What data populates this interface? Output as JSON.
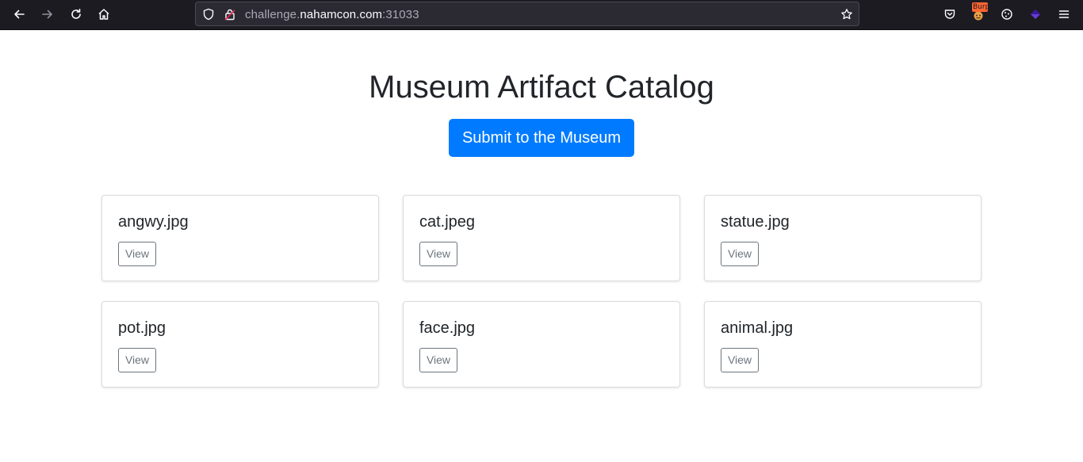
{
  "browser": {
    "url_prefix": "challenge.",
    "url_domain": "nahamcon.com",
    "url_suffix": ":31033",
    "burp_badge": "Burp",
    "toolbar_icons": [
      "back-icon",
      "forward-icon",
      "reload-icon",
      "home-icon",
      "shield-icon",
      "lock-icon",
      "star-icon",
      "pocket-icon",
      "burp-extension-icon",
      "cookie-icon",
      "extension-icon",
      "menu-icon"
    ]
  },
  "page": {
    "title": "Museum Artifact Catalog",
    "submit_label": "Submit to the Museum"
  },
  "artifacts": [
    {
      "name": "angwy.jpg",
      "view_label": "View"
    },
    {
      "name": "cat.jpeg",
      "view_label": "View"
    },
    {
      "name": "statue.jpg",
      "view_label": "View"
    },
    {
      "name": "pot.jpg",
      "view_label": "View"
    },
    {
      "name": "face.jpg",
      "view_label": "View"
    },
    {
      "name": "animal.jpg",
      "view_label": "View"
    }
  ],
  "colors": {
    "primary": "#007bff",
    "secondary": "#6c757d",
    "chrome_bg": "#1c1b22",
    "urlbar_bg": "#2b2a33"
  }
}
